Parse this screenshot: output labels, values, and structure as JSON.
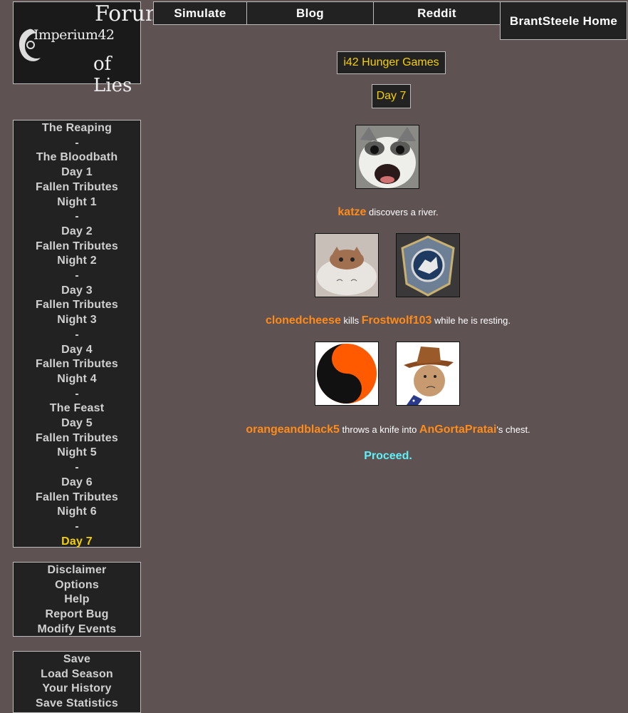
{
  "logo": {
    "left_text": "Imperium42",
    "right_line1": "Forum",
    "right_line2": "of Lies"
  },
  "topnav": {
    "simulate": "Simulate",
    "blog": "Blog",
    "reddit": "Reddit",
    "home": "BrantSteele Home"
  },
  "sidebar": {
    "reaping": "The Reaping",
    "bloodbath": "The Bloodbath",
    "day1": "Day 1",
    "fallen1": "Fallen Tributes",
    "night1": "Night 1",
    "day2": "Day 2",
    "fallen2": "Fallen Tributes",
    "night2": "Night 2",
    "day3": "Day 3",
    "fallen3": "Fallen Tributes",
    "night3": "Night 3",
    "day4": "Day 4",
    "fallen4": "Fallen Tributes",
    "night4": "Night 4",
    "feast": "The Feast",
    "day5": "Day 5",
    "fallen5": "Fallen Tributes",
    "night5": "Night 5",
    "day6": "Day 6",
    "fallen6": "Fallen Tributes",
    "night6": "Night 6",
    "day7": "Day 7",
    "dash": "-"
  },
  "menu2": {
    "disclaimer": "Disclaimer",
    "options": "Options",
    "help": "Help",
    "report": "Report Bug",
    "modify": "Modify Events"
  },
  "menu3": {
    "save": "Save",
    "load": "Load Season",
    "history": "Your History",
    "stats": "Save Statistics"
  },
  "main": {
    "game_title": "i42 Hunger Games",
    "day_title": "Day 7",
    "events": [
      {
        "p1": "katze",
        "t1": " discovers a river."
      },
      {
        "p1": "clonedcheese",
        "t1": " kills ",
        "p2": "Frostwolf103",
        "t2": " while he is resting."
      },
      {
        "p1": "orangeandblack5",
        "t1": " throws a knife into ",
        "p2": "AnGortaPratai",
        "t2": "'s chest."
      }
    ],
    "proceed": "Proceed."
  },
  "colors": {
    "background": "#5e5252",
    "panel": "#222222",
    "accent_yellow": "#f5d000",
    "player_orange": "#ff8c1a",
    "proceed_cyan": "#5ff0f8"
  }
}
